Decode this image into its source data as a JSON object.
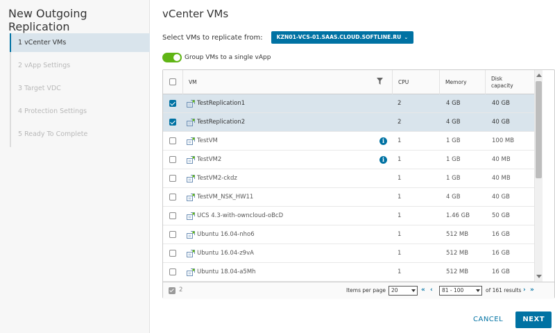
{
  "wizard": {
    "title": "New Outgoing Replication",
    "steps": [
      {
        "label": "1 vCenter VMs",
        "active": true
      },
      {
        "label": "2 vApp Settings",
        "active": false
      },
      {
        "label": "3 Target VDC",
        "active": false
      },
      {
        "label": "4 Protection Settings",
        "active": false
      },
      {
        "label": "5 Ready To Complete",
        "active": false
      }
    ]
  },
  "page": {
    "title": "vCenter VMs",
    "select_label": "Select VMs to replicate from:",
    "vcenter": "KZN01-VCS-01.SAAS.CLOUD.SOFTLINE.RU",
    "group_toggle_label": "Group VMs to a single vApp",
    "group_toggle_on": true
  },
  "grid": {
    "columns": {
      "vm": "VM",
      "cpu": "CPU",
      "memory": "Memory",
      "disk": "Disk capacity"
    },
    "rows": [
      {
        "name": "TestReplication1",
        "cpu": "2",
        "memory": "4 GB",
        "disk": "40 GB",
        "selected": true,
        "info": false
      },
      {
        "name": "TestReplication2",
        "cpu": "2",
        "memory": "4 GB",
        "disk": "40 GB",
        "selected": true,
        "info": false
      },
      {
        "name": "TestVM",
        "cpu": "1",
        "memory": "1 GB",
        "disk": "100 MB",
        "selected": false,
        "info": true
      },
      {
        "name": "TestVM2",
        "cpu": "1",
        "memory": "1 GB",
        "disk": "40 MB",
        "selected": false,
        "info": true
      },
      {
        "name": "TestVM2-ckdz",
        "cpu": "1",
        "memory": "1 GB",
        "disk": "40 MB",
        "selected": false,
        "info": false
      },
      {
        "name": "TestVM_NSK_HW11",
        "cpu": "1",
        "memory": "4 GB",
        "disk": "40 GB",
        "selected": false,
        "info": false
      },
      {
        "name": "UCS 4.3-with-owncloud-oBcD",
        "cpu": "1",
        "memory": "1.46 GB",
        "disk": "50 GB",
        "selected": false,
        "info": false
      },
      {
        "name": "Ubuntu 16.04-nho6",
        "cpu": "1",
        "memory": "512 MB",
        "disk": "16 GB",
        "selected": false,
        "info": false
      },
      {
        "name": "Ubuntu 16.04-z9vA",
        "cpu": "1",
        "memory": "512 MB",
        "disk": "16 GB",
        "selected": false,
        "info": false
      },
      {
        "name": "Ubuntu 18.04-a5Mh",
        "cpu": "1",
        "memory": "512 MB",
        "disk": "16 GB",
        "selected": false,
        "info": false
      }
    ],
    "footer": {
      "selected_count": "2",
      "items_per_page_label": "Items per page",
      "items_per_page": "20",
      "range": "81 - 100",
      "total": "of 161 results"
    }
  },
  "actions": {
    "cancel": "CANCEL",
    "next": "NEXT"
  },
  "colors": {
    "accent": "#0072a3",
    "toggle_on": "#60b515",
    "selected_row": "#d9e4ec"
  }
}
